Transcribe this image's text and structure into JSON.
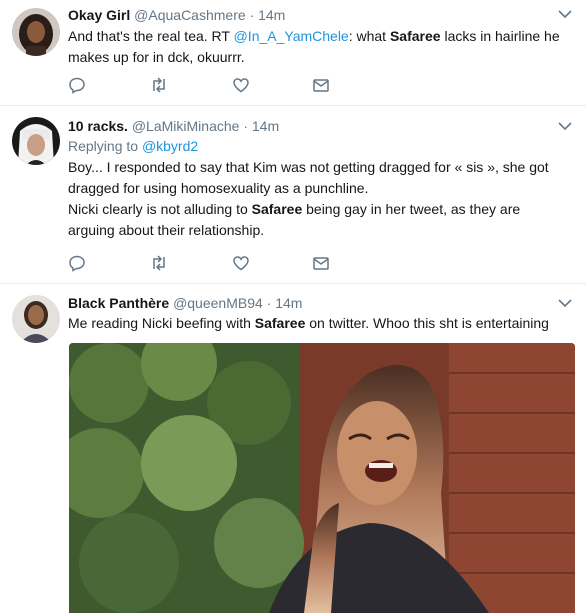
{
  "tweets": [
    {
      "fullname": "Okay Girl",
      "handle": "@AquaCashmere",
      "separator": "·",
      "time": "14m",
      "text_a": "And that's the real tea. RT ",
      "mention": "@In_A_YamChele",
      "text_b": ": what ",
      "bold": "Safaree",
      "text_c": " lacks in hairline he makes up for in d",
      "text_d": "ck, okuurrr."
    },
    {
      "fullname": "10 racks.",
      "handle": "@LaMikiMinache",
      "separator": "·",
      "time": "14m",
      "replying_label": "Replying to",
      "replying_to": "@kbyrd2",
      "line1": "Boy... I responded to say that Kim was not getting dragged for « sis », she got dragged for using homosexuality as a punchline.",
      "line2_a": "Nicki clearly is not alluding to ",
      "bold": "Safaree",
      "line2_b": " being gay in her tweet, as they are arguing about their relationship."
    },
    {
      "fullname": "Black Panthère",
      "handle": "@queenMB94",
      "separator": "·",
      "time": "14m",
      "text_a": "Me reading Nicki beefing with ",
      "bold": "Safaree",
      "text_b": " on twitter. Whoo this sh",
      "text_c": "t is entertaining"
    }
  ],
  "icons": {
    "reply": "reply-icon",
    "retweet": "retweet-icon",
    "like": "heart-icon",
    "dm": "envelope-icon",
    "caret": "chevron-down-icon"
  },
  "colors": {
    "link": "#1b95e0",
    "muted": "#657786",
    "text": "#14171a",
    "divider": "#e6ecf0"
  }
}
